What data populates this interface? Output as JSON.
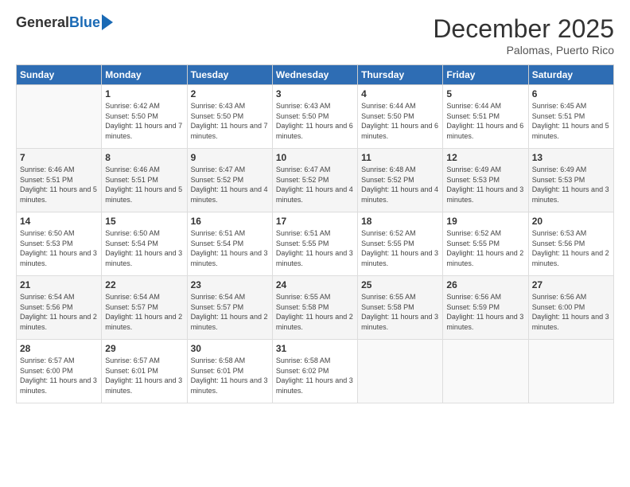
{
  "logo": {
    "general": "General",
    "blue": "Blue"
  },
  "title": {
    "month": "December 2025",
    "location": "Palomas, Puerto Rico"
  },
  "headers": [
    "Sunday",
    "Monday",
    "Tuesday",
    "Wednesday",
    "Thursday",
    "Friday",
    "Saturday"
  ],
  "weeks": [
    [
      {
        "day": "",
        "empty": true
      },
      {
        "day": "1",
        "sunrise": "Sunrise: 6:42 AM",
        "sunset": "Sunset: 5:50 PM",
        "daylight": "Daylight: 11 hours and 7 minutes."
      },
      {
        "day": "2",
        "sunrise": "Sunrise: 6:43 AM",
        "sunset": "Sunset: 5:50 PM",
        "daylight": "Daylight: 11 hours and 7 minutes."
      },
      {
        "day": "3",
        "sunrise": "Sunrise: 6:43 AM",
        "sunset": "Sunset: 5:50 PM",
        "daylight": "Daylight: 11 hours and 6 minutes."
      },
      {
        "day": "4",
        "sunrise": "Sunrise: 6:44 AM",
        "sunset": "Sunset: 5:50 PM",
        "daylight": "Daylight: 11 hours and 6 minutes."
      },
      {
        "day": "5",
        "sunrise": "Sunrise: 6:44 AM",
        "sunset": "Sunset: 5:51 PM",
        "daylight": "Daylight: 11 hours and 6 minutes."
      },
      {
        "day": "6",
        "sunrise": "Sunrise: 6:45 AM",
        "sunset": "Sunset: 5:51 PM",
        "daylight": "Daylight: 11 hours and 5 minutes."
      }
    ],
    [
      {
        "day": "7",
        "sunrise": "Sunrise: 6:46 AM",
        "sunset": "Sunset: 5:51 PM",
        "daylight": "Daylight: 11 hours and 5 minutes."
      },
      {
        "day": "8",
        "sunrise": "Sunrise: 6:46 AM",
        "sunset": "Sunset: 5:51 PM",
        "daylight": "Daylight: 11 hours and 5 minutes."
      },
      {
        "day": "9",
        "sunrise": "Sunrise: 6:47 AM",
        "sunset": "Sunset: 5:52 PM",
        "daylight": "Daylight: 11 hours and 4 minutes."
      },
      {
        "day": "10",
        "sunrise": "Sunrise: 6:47 AM",
        "sunset": "Sunset: 5:52 PM",
        "daylight": "Daylight: 11 hours and 4 minutes."
      },
      {
        "day": "11",
        "sunrise": "Sunrise: 6:48 AM",
        "sunset": "Sunset: 5:52 PM",
        "daylight": "Daylight: 11 hours and 4 minutes."
      },
      {
        "day": "12",
        "sunrise": "Sunrise: 6:49 AM",
        "sunset": "Sunset: 5:53 PM",
        "daylight": "Daylight: 11 hours and 3 minutes."
      },
      {
        "day": "13",
        "sunrise": "Sunrise: 6:49 AM",
        "sunset": "Sunset: 5:53 PM",
        "daylight": "Daylight: 11 hours and 3 minutes."
      }
    ],
    [
      {
        "day": "14",
        "sunrise": "Sunrise: 6:50 AM",
        "sunset": "Sunset: 5:53 PM",
        "daylight": "Daylight: 11 hours and 3 minutes."
      },
      {
        "day": "15",
        "sunrise": "Sunrise: 6:50 AM",
        "sunset": "Sunset: 5:54 PM",
        "daylight": "Daylight: 11 hours and 3 minutes."
      },
      {
        "day": "16",
        "sunrise": "Sunrise: 6:51 AM",
        "sunset": "Sunset: 5:54 PM",
        "daylight": "Daylight: 11 hours and 3 minutes."
      },
      {
        "day": "17",
        "sunrise": "Sunrise: 6:51 AM",
        "sunset": "Sunset: 5:55 PM",
        "daylight": "Daylight: 11 hours and 3 minutes."
      },
      {
        "day": "18",
        "sunrise": "Sunrise: 6:52 AM",
        "sunset": "Sunset: 5:55 PM",
        "daylight": "Daylight: 11 hours and 3 minutes."
      },
      {
        "day": "19",
        "sunrise": "Sunrise: 6:52 AM",
        "sunset": "Sunset: 5:55 PM",
        "daylight": "Daylight: 11 hours and 2 minutes."
      },
      {
        "day": "20",
        "sunrise": "Sunrise: 6:53 AM",
        "sunset": "Sunset: 5:56 PM",
        "daylight": "Daylight: 11 hours and 2 minutes."
      }
    ],
    [
      {
        "day": "21",
        "sunrise": "Sunrise: 6:54 AM",
        "sunset": "Sunset: 5:56 PM",
        "daylight": "Daylight: 11 hours and 2 minutes."
      },
      {
        "day": "22",
        "sunrise": "Sunrise: 6:54 AM",
        "sunset": "Sunset: 5:57 PM",
        "daylight": "Daylight: 11 hours and 2 minutes."
      },
      {
        "day": "23",
        "sunrise": "Sunrise: 6:54 AM",
        "sunset": "Sunset: 5:57 PM",
        "daylight": "Daylight: 11 hours and 2 minutes."
      },
      {
        "day": "24",
        "sunrise": "Sunrise: 6:55 AM",
        "sunset": "Sunset: 5:58 PM",
        "daylight": "Daylight: 11 hours and 2 minutes."
      },
      {
        "day": "25",
        "sunrise": "Sunrise: 6:55 AM",
        "sunset": "Sunset: 5:58 PM",
        "daylight": "Daylight: 11 hours and 3 minutes."
      },
      {
        "day": "26",
        "sunrise": "Sunrise: 6:56 AM",
        "sunset": "Sunset: 5:59 PM",
        "daylight": "Daylight: 11 hours and 3 minutes."
      },
      {
        "day": "27",
        "sunrise": "Sunrise: 6:56 AM",
        "sunset": "Sunset: 6:00 PM",
        "daylight": "Daylight: 11 hours and 3 minutes."
      }
    ],
    [
      {
        "day": "28",
        "sunrise": "Sunrise: 6:57 AM",
        "sunset": "Sunset: 6:00 PM",
        "daylight": "Daylight: 11 hours and 3 minutes."
      },
      {
        "day": "29",
        "sunrise": "Sunrise: 6:57 AM",
        "sunset": "Sunset: 6:01 PM",
        "daylight": "Daylight: 11 hours and 3 minutes."
      },
      {
        "day": "30",
        "sunrise": "Sunrise: 6:58 AM",
        "sunset": "Sunset: 6:01 PM",
        "daylight": "Daylight: 11 hours and 3 minutes."
      },
      {
        "day": "31",
        "sunrise": "Sunrise: 6:58 AM",
        "sunset": "Sunset: 6:02 PM",
        "daylight": "Daylight: 11 hours and 3 minutes."
      },
      {
        "day": "",
        "empty": true
      },
      {
        "day": "",
        "empty": true
      },
      {
        "day": "",
        "empty": true
      }
    ]
  ]
}
